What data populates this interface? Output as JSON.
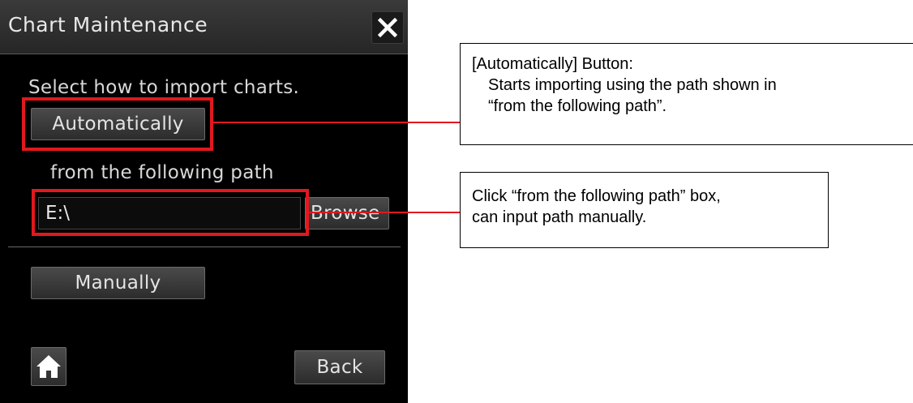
{
  "dialog": {
    "title": "Chart Maintenance",
    "close_icon": "close-icon",
    "prompt": "Select how to import charts.",
    "automatically_label": "Automatically",
    "path_label": "from the following path",
    "path_value": "E:\\",
    "browse_label": "Browse",
    "manually_label": "Manually",
    "home_icon": "home-icon",
    "back_label": "Back"
  },
  "annotations": {
    "callout_1": {
      "heading": "[Automatically] Button:",
      "line_2": "Starts importing using the path shown in",
      "line_3": "“from the following path”."
    },
    "callout_2": {
      "line_1": "Click “from the following path” box,",
      "line_2": "can input path manually."
    }
  },
  "colors": {
    "panel_background": "#000000",
    "highlight": "#e0191e",
    "button_text": "#e4e4e4"
  }
}
